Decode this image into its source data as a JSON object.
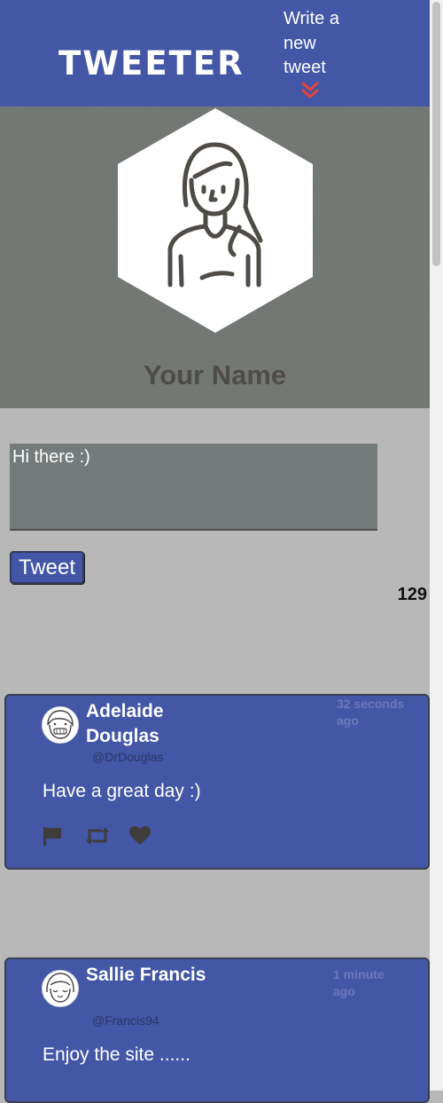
{
  "nav": {
    "brand": "TWEETER",
    "write_link": "Write a new tweet"
  },
  "profile": {
    "name": "Your Name"
  },
  "composer": {
    "placeholder": "Hi there :)",
    "button_label": "Tweet",
    "counter": "129"
  },
  "tweets": [
    {
      "name": "Adelaide Douglas",
      "handle": "@DrDouglas",
      "time": "32 seconds ago",
      "text": "Have a great day :)"
    },
    {
      "name": "Sallie Francis",
      "handle": "@Francis94",
      "time": "1 minute ago",
      "text": "Enjoy the site ......"
    }
  ],
  "icons": {
    "write": "double-chevron-down-icon",
    "flag": "flag-icon",
    "retweet": "retweet-icon",
    "like": "heart-icon"
  },
  "colors": {
    "brand_blue": "#4357a6",
    "accent_red": "#e8423a",
    "profile_bg": "#737874",
    "page_bg": "#b8b8b8"
  }
}
